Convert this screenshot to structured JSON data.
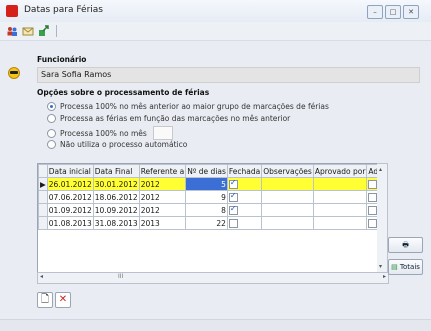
{
  "window": {
    "title": "Datas para Férias",
    "buttons": [
      "–",
      "□",
      "✕"
    ]
  },
  "toolbar": {
    "icons": [
      "users-icon",
      "mail-icon",
      "export-icon"
    ]
  },
  "employee": {
    "section_label": "Funcionário",
    "name": "Sara Sofia Ramos"
  },
  "options": {
    "section_label": "Opções sobre o processamento de férias",
    "items": [
      {
        "label": "Processa 100% no mês anterior ao maior grupo de marcações de férias",
        "selected": true
      },
      {
        "label": "Processa as férias em função das marcações no mês anterior",
        "selected": false
      },
      {
        "label": "Processa 100% no mês",
        "selected": false
      },
      {
        "label": "Não utiliza o processo automático",
        "selected": false
      }
    ]
  },
  "grid": {
    "columns": [
      "Data inicial",
      "Data Final",
      "Referente a",
      "Nº de dias",
      "Fechada",
      "Observações",
      "Aprovado por",
      "Ad"
    ],
    "rows": [
      {
        "start": "26.01.2012",
        "end": "30.01.2012",
        "ref": "2012",
        "days": "5",
        "closed": true,
        "selected": true
      },
      {
        "start": "07.06.2012",
        "end": "18.06.2012",
        "ref": "2012",
        "days": "9",
        "closed": true,
        "selected": false
      },
      {
        "start": "01.09.2012",
        "end": "10.09.2012",
        "ref": "2012",
        "days": "8",
        "closed": true,
        "selected": false
      },
      {
        "start": "01.08.2013",
        "end": "31.08.2013",
        "ref": "2013",
        "days": "22",
        "closed": false,
        "selected": false
      }
    ],
    "row_marker": "▶",
    "scroll_left": "◂",
    "scroll_mid": "III",
    "scroll_right": "▸"
  },
  "side_buttons": {
    "print": "🖶",
    "totals": "Totais"
  },
  "bottom_buttons": {
    "new": "🗋",
    "delete": "✕"
  }
}
